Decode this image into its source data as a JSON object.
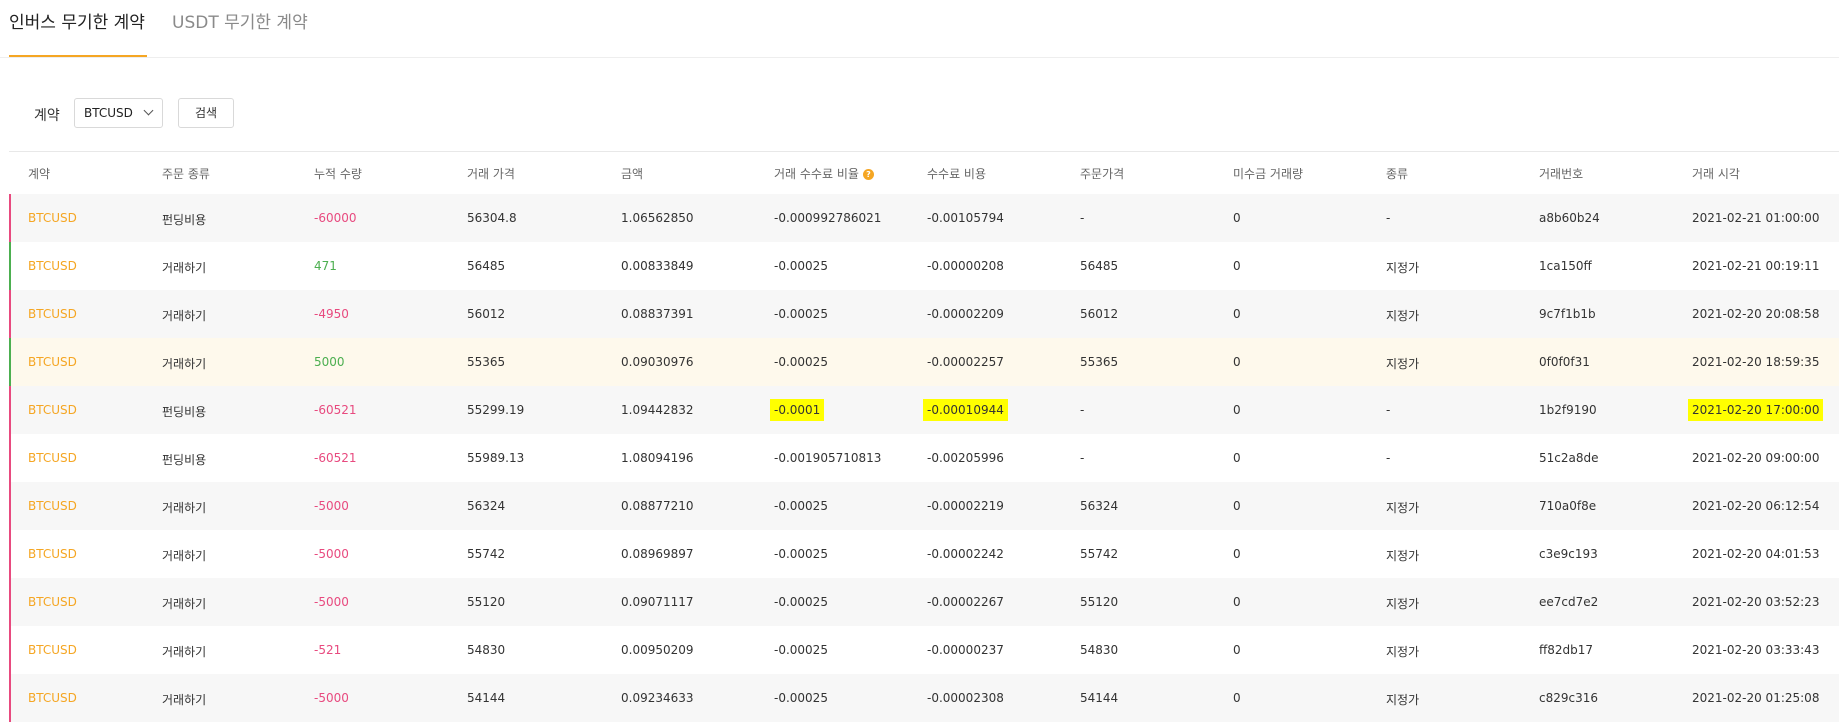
{
  "tabs": [
    {
      "label": "인버스 무기한 계약",
      "active": true
    },
    {
      "label": "USDT 무기한 계약",
      "active": false
    }
  ],
  "filter": {
    "label": "계약",
    "select_value": "BTCUSD",
    "search_label": "검색"
  },
  "colors": {
    "accent": "#f5a623",
    "positive": "#4caf50",
    "negative": "#e84a7f",
    "highlight": "#ffff00"
  },
  "table": {
    "headers": [
      "계약",
      "주문 종류",
      "누적 수량",
      "거래 가격",
      "금액",
      "거래 수수료 비율",
      "수수료 비용",
      "주문가격",
      "미수금 거래량",
      "종류",
      "거래번호",
      "거래 시각"
    ],
    "help_icon": "?",
    "rows": [
      {
        "contract": "BTCUSD",
        "type": "펀딩비용",
        "qty": "-60000",
        "price": "56304.8",
        "amount": "1.06562850",
        "fee_rate": "-0.000992786021",
        "fee": "-0.00105794",
        "order_price": "-",
        "unfilled": "0",
        "kind": "-",
        "trade_id": "a8b60b24",
        "time": "2021-02-21 01:00:00",
        "side": "sell"
      },
      {
        "contract": "BTCUSD",
        "type": "거래하기",
        "qty": "471",
        "price": "56485",
        "amount": "0.00833849",
        "fee_rate": "-0.00025",
        "fee": "-0.00000208",
        "order_price": "56485",
        "unfilled": "0",
        "kind": "지정가",
        "trade_id": "1ca150ff",
        "time": "2021-02-21 00:19:11",
        "side": "buy"
      },
      {
        "contract": "BTCUSD",
        "type": "거래하기",
        "qty": "-4950",
        "price": "56012",
        "amount": "0.08837391",
        "fee_rate": "-0.00025",
        "fee": "-0.00002209",
        "order_price": "56012",
        "unfilled": "0",
        "kind": "지정가",
        "trade_id": "9c7f1b1b",
        "time": "2021-02-20 20:08:58",
        "side": "sell"
      },
      {
        "contract": "BTCUSD",
        "type": "거래하기",
        "qty": "5000",
        "price": "55365",
        "amount": "0.09030976",
        "fee_rate": "-0.00025",
        "fee": "-0.00002257",
        "order_price": "55365",
        "unfilled": "0",
        "kind": "지정가",
        "trade_id": "0f0f0f31",
        "time": "2021-02-20 18:59:35",
        "side": "buy",
        "hover": true
      },
      {
        "contract": "BTCUSD",
        "type": "펀딩비용",
        "qty": "-60521",
        "price": "55299.19",
        "amount": "1.09442832",
        "fee_rate": "-0.0001",
        "fee": "-0.00010944",
        "order_price": "-",
        "unfilled": "0",
        "kind": "-",
        "trade_id": "1b2f9190",
        "time": "2021-02-20 17:00:00",
        "side": "sell",
        "highlight": true
      },
      {
        "contract": "BTCUSD",
        "type": "펀딩비용",
        "qty": "-60521",
        "price": "55989.13",
        "amount": "1.08094196",
        "fee_rate": "-0.001905710813",
        "fee": "-0.00205996",
        "order_price": "-",
        "unfilled": "0",
        "kind": "-",
        "trade_id": "51c2a8de",
        "time": "2021-02-20 09:00:00",
        "side": "sell"
      },
      {
        "contract": "BTCUSD",
        "type": "거래하기",
        "qty": "-5000",
        "price": "56324",
        "amount": "0.08877210",
        "fee_rate": "-0.00025",
        "fee": "-0.00002219",
        "order_price": "56324",
        "unfilled": "0",
        "kind": "지정가",
        "trade_id": "710a0f8e",
        "time": "2021-02-20 06:12:54",
        "side": "sell"
      },
      {
        "contract": "BTCUSD",
        "type": "거래하기",
        "qty": "-5000",
        "price": "55742",
        "amount": "0.08969897",
        "fee_rate": "-0.00025",
        "fee": "-0.00002242",
        "order_price": "55742",
        "unfilled": "0",
        "kind": "지정가",
        "trade_id": "c3e9c193",
        "time": "2021-02-20 04:01:53",
        "side": "sell"
      },
      {
        "contract": "BTCUSD",
        "type": "거래하기",
        "qty": "-5000",
        "price": "55120",
        "amount": "0.09071117",
        "fee_rate": "-0.00025",
        "fee": "-0.00002267",
        "order_price": "55120",
        "unfilled": "0",
        "kind": "지정가",
        "trade_id": "ee7cd7e2",
        "time": "2021-02-20 03:52:23",
        "side": "sell"
      },
      {
        "contract": "BTCUSD",
        "type": "거래하기",
        "qty": "-521",
        "price": "54830",
        "amount": "0.00950209",
        "fee_rate": "-0.00025",
        "fee": "-0.00000237",
        "order_price": "54830",
        "unfilled": "0",
        "kind": "지정가",
        "trade_id": "ff82db17",
        "time": "2021-02-20 03:33:43",
        "side": "sell"
      },
      {
        "contract": "BTCUSD",
        "type": "거래하기",
        "qty": "-5000",
        "price": "54144",
        "amount": "0.09234633",
        "fee_rate": "-0.00025",
        "fee": "-0.00002308",
        "order_price": "54144",
        "unfilled": "0",
        "kind": "지정가",
        "trade_id": "c829c316",
        "time": "2021-02-20 01:25:08",
        "side": "sell"
      }
    ]
  }
}
